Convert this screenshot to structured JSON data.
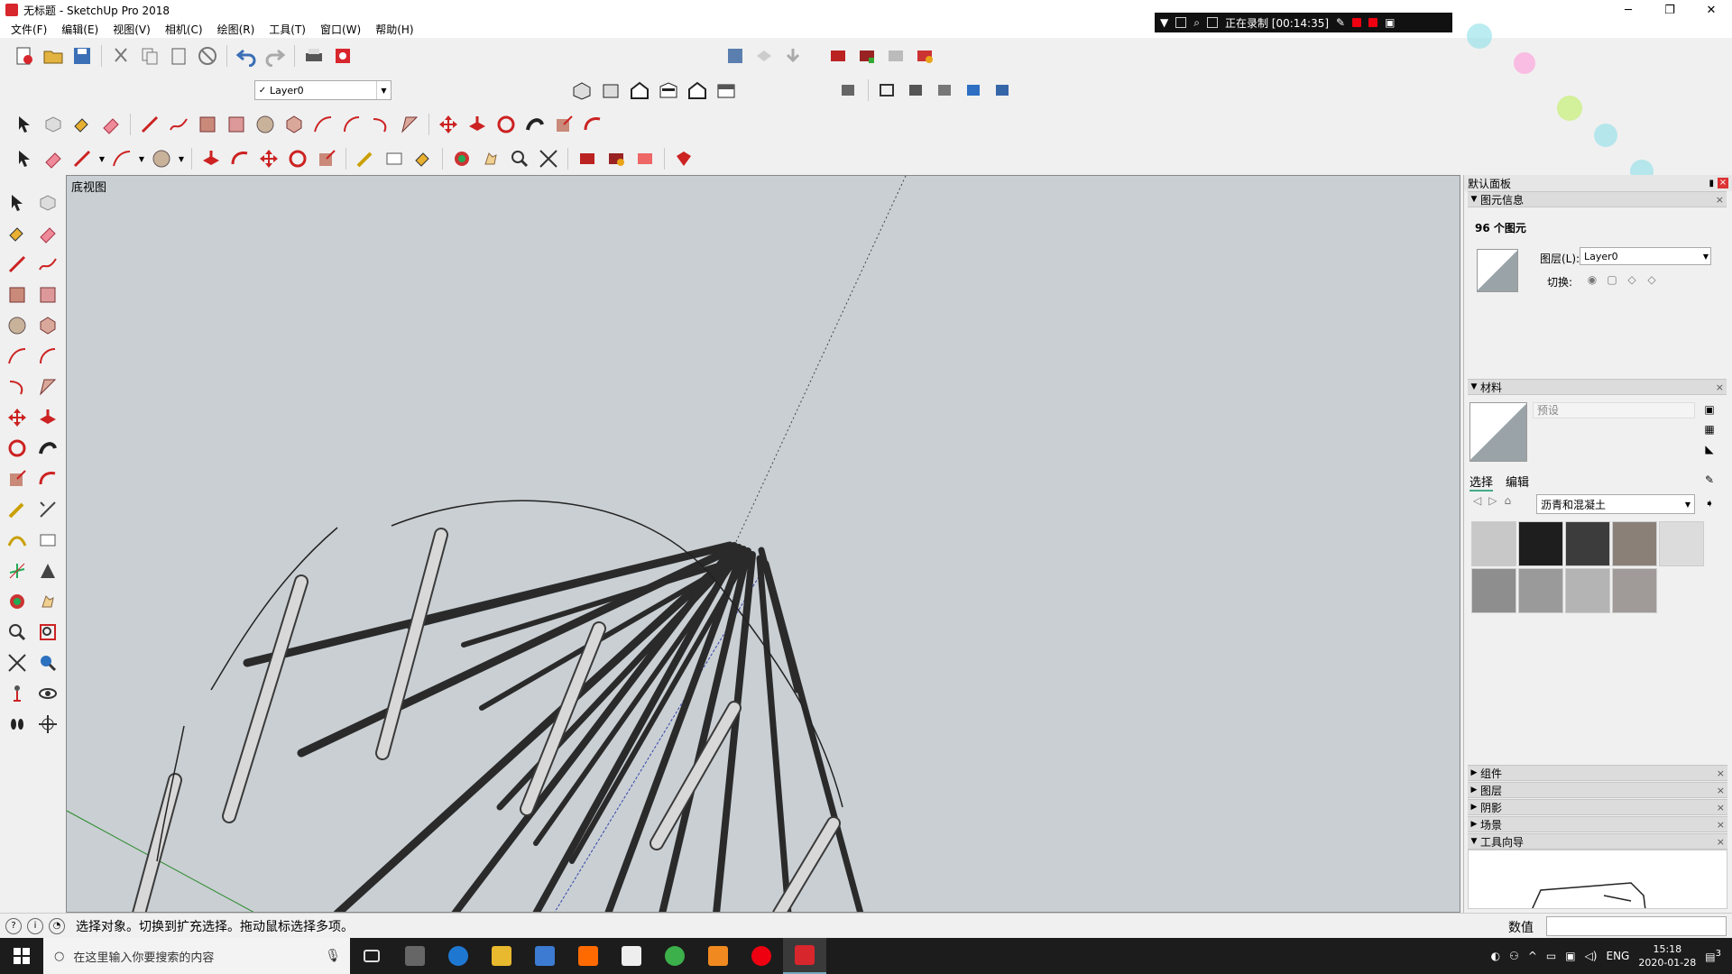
{
  "window": {
    "title": "无标题 - SketchUp Pro 2018",
    "controls": [
      "─",
      "❐",
      "✕"
    ]
  },
  "recording": {
    "status": "正在录制 [00:14:35]"
  },
  "menu": [
    "文件(F)",
    "编辑(E)",
    "视图(V)",
    "相机(C)",
    "绘图(R)",
    "工具(T)",
    "窗口(W)",
    "帮助(H)"
  ],
  "layer_toolbar": {
    "check": "✓",
    "value": "Layer0"
  },
  "viewport": {
    "scene_label": "底视图"
  },
  "right_panel": {
    "title": "默认面板",
    "entity_info": {
      "header": "图元信息",
      "count": "96 个图元",
      "layer_label": "图层(L):",
      "layer_value": "Layer0",
      "toggle_label": "切换:"
    },
    "materials": {
      "header": "材料",
      "name_placeholder": "预设",
      "tab_select": "选择",
      "tab_edit": "编辑",
      "collection": "沥青和混凝土",
      "swatch_colors": [
        "#c8c8c8",
        "#1e1e1e",
        "#3c3c3c",
        "#8a8078",
        "#dcdcdc",
        "#8e8e8e",
        "#9a9a9a",
        "#b4b4b4",
        "#a09a98"
      ]
    },
    "collapsed": [
      "组件",
      "图层",
      "阴影",
      "场景",
      "工具向导"
    ]
  },
  "statusbar": {
    "message": "选择对象。切换到扩充选择。拖动鼠标选择多项。",
    "value_label": "数值"
  },
  "taskbar": {
    "search_placeholder": "在这里输入你要搜索的内容",
    "lang": "ENG",
    "time": "15:18",
    "date": "2020-01-28",
    "notif": "3"
  },
  "colors": {
    "viewport_bg": "#c9cfd3",
    "accent_red": "#d8262d"
  }
}
